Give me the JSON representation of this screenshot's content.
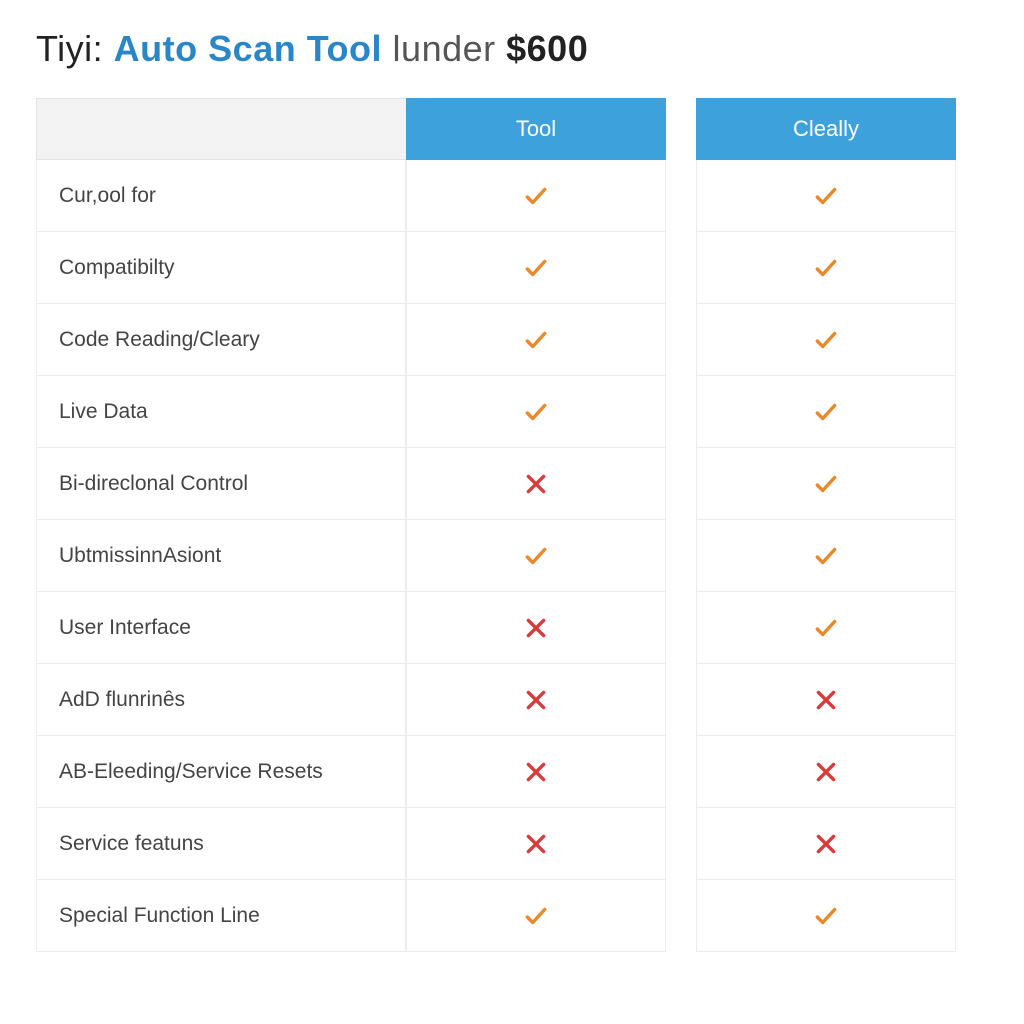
{
  "title": {
    "pre": "Tiyі:",
    "auto": "Auto",
    "scan": "Scan",
    "tool": "Tool",
    "under": "lunder",
    "price": "$600"
  },
  "columns": {
    "tool": "Tool",
    "cleally": "Cleally"
  },
  "rows": [
    {
      "label": "Cur,ool for",
      "tool": "check",
      "cleally": "check"
    },
    {
      "label": "Compatibilty",
      "tool": "check",
      "cleally": "check"
    },
    {
      "label": "Code Reading/Cleary",
      "tool": "check",
      "cleally": "check"
    },
    {
      "label": "Live Data",
      "tool": "check",
      "cleally": "check"
    },
    {
      "label": "Bi-direclonal Control",
      "tool": "cross",
      "cleally": "check"
    },
    {
      "label": "UbtmissinnAsiont",
      "tool": "check",
      "cleally": "check"
    },
    {
      "label": "User Interface",
      "tool": "cross",
      "cleally": "check"
    },
    {
      "label": "AdD flunrinȇs",
      "tool": "cross",
      "cleally": "cross"
    },
    {
      "label": "AB-Eleeding/Service Resets",
      "tool": "cross",
      "cleally": "cross"
    },
    {
      "label": "Service featuns",
      "tool": "cross",
      "cleally": "cross"
    },
    {
      "label": "Special Function Line",
      "tool": "check",
      "cleally": "check"
    }
  ]
}
